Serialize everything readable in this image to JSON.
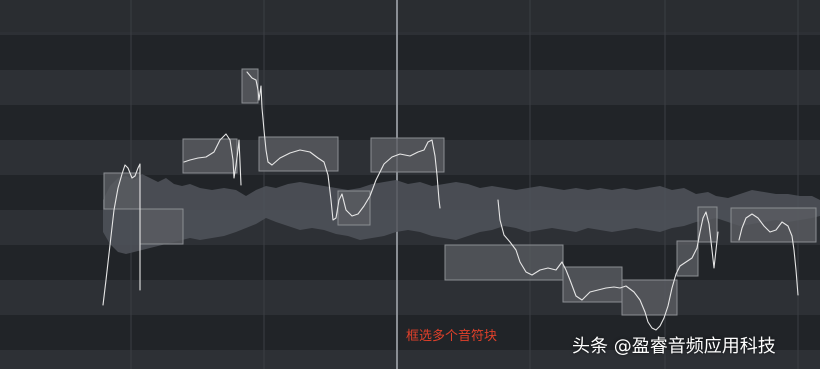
{
  "overlay": {
    "caption": "框选多个音符块",
    "watermark": "头条 @盈睿音频应用科技"
  },
  "colors": {
    "background": "#25282c",
    "row_light": "#2d3035",
    "row_dark": "#212428",
    "grid_line": "#3a3e44",
    "playhead": "#8a8e94",
    "waveform": "#50545a",
    "note_fill": "#5a5d61",
    "note_border": "#8b8e92",
    "pitch_curve": "#e6e6e6",
    "caption": "#e0402a",
    "watermark": "#ffffff"
  },
  "icons": {
    "note_blob": "rectangle-block",
    "pitch_curve": "freehand-line"
  }
}
